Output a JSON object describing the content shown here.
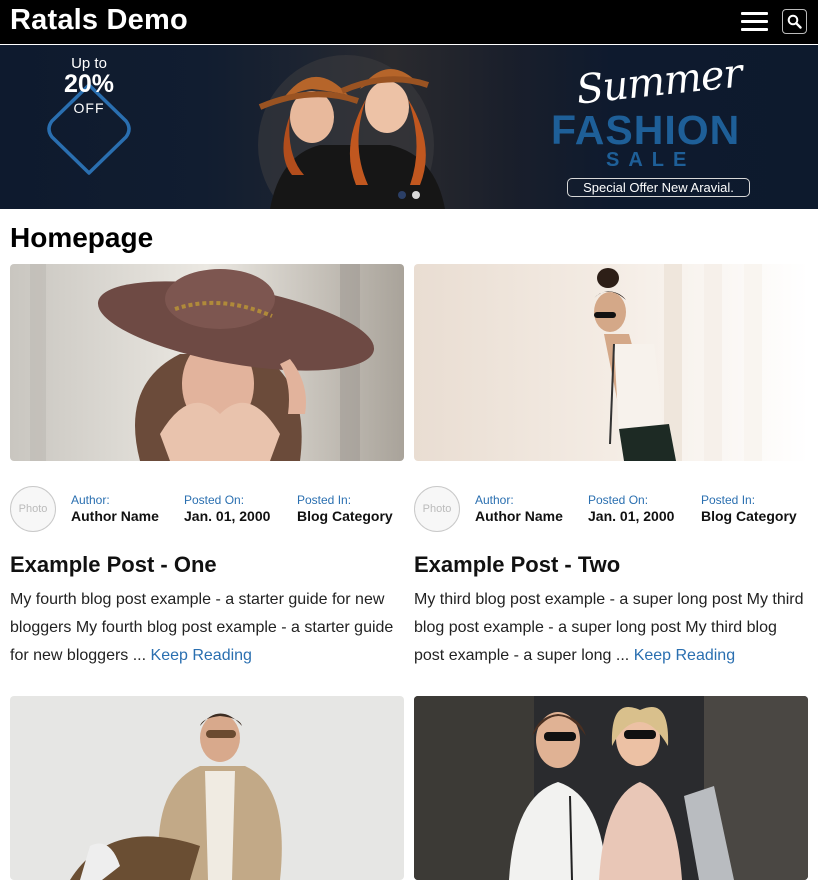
{
  "header": {
    "site_title": "Ratals Demo",
    "menu_icon": "hamburger-menu-icon",
    "search_icon": "search-icon"
  },
  "banner": {
    "badge_line1": "Up to",
    "badge_line2": "20%",
    "badge_line3": "OFF",
    "script_title": "Summer",
    "headline": "FASHION",
    "subheadline": "SALE",
    "offer": "Special Offer New Aravial.",
    "slide_count": 2,
    "active_slide": 1,
    "colors": {
      "navy": "#0e1a2e",
      "blue": "#1e5f98"
    }
  },
  "page": {
    "title": "Homepage"
  },
  "posts": [
    {
      "avatar_text": "Photo",
      "author_label": "Author:",
      "author_name": "Author Name",
      "posted_on_label": "Posted On:",
      "posted_on": "Jan. 01, 2000",
      "posted_in_label": "Posted In:",
      "category": "Blog Category",
      "title": "Example Post - One",
      "excerpt": "My fourth blog post example - a starter guide for new bloggers My fourth blog post example - a starter guide for new bloggers ...",
      "read_more": "Keep Reading"
    },
    {
      "avatar_text": "Photo",
      "author_label": "Author:",
      "author_name": "Author Name",
      "posted_on_label": "Posted On:",
      "posted_on": "Jan. 01, 2000",
      "posted_in_label": "Posted In:",
      "category": "Blog Category",
      "title": "Example Post - Two",
      "excerpt": "My third blog post example - a super long post My third blog post example - a super long post My third blog post example - a super long ...",
      "read_more": "Keep Reading"
    }
  ],
  "colors": {
    "link": "#2a6fb0",
    "header_bg": "#000000"
  }
}
